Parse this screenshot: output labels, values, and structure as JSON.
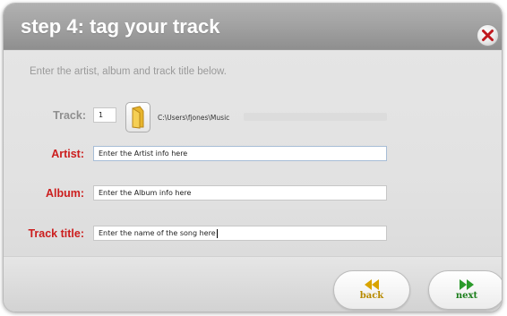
{
  "dialog": {
    "title": "step 4: tag your track",
    "instruction": "Enter the artist, album and track title below."
  },
  "fields": {
    "track": {
      "label": "Track:",
      "number": "1",
      "path": "C:\\Users\\fjones\\Music"
    },
    "artist": {
      "label": "Artist:",
      "value": "Enter the Artist info here"
    },
    "album": {
      "label": "Album:",
      "value": "Enter the Album info here"
    },
    "track_title": {
      "label": "Track title:",
      "value": "Enter the name of the song here"
    }
  },
  "nav": {
    "back_label": "back",
    "next_label": "next"
  },
  "icons": {
    "close": "close-x-icon",
    "folder": "folder-icon",
    "back": "double-chevron-left-icon",
    "next": "double-chevron-right-icon"
  },
  "colors": {
    "required_label": "#cc1d1d",
    "back_accent": "#d9a400",
    "next_accent": "#2a9a2a",
    "close_accent": "#c0181e"
  }
}
